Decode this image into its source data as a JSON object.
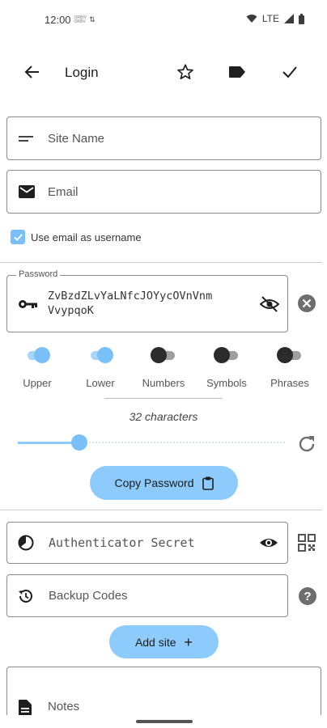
{
  "status_bar": {
    "time": "12:00",
    "tiny1": "ORBIV",
    "tiny2": "ORBV",
    "network": "LTE"
  },
  "app_bar": {
    "title": "Login"
  },
  "fields": {
    "site_name": "Site Name",
    "email": "Email",
    "use_email_label": "Use email as username",
    "password_label": "Password",
    "password_value_line1": "ZvBzdZLvYaLNfcJOYycOVnVnm",
    "password_value_line2": "VvypqoK",
    "authenticator_placeholder": "Authenticator Secret",
    "backup_codes": "Backup Codes",
    "notes": "Notes"
  },
  "options": [
    {
      "label": "Upper",
      "on": true
    },
    {
      "label": "Lower",
      "on": true
    },
    {
      "label": "Numbers",
      "on": false
    },
    {
      "label": "Symbols",
      "on": false
    },
    {
      "label": "Phrases",
      "on": false
    }
  ],
  "length": {
    "label": "32 characters",
    "value": 32,
    "fill_fraction": 0.23
  },
  "buttons": {
    "copy_password": "Copy Password",
    "add_site": "Add site"
  },
  "colors": {
    "accent": "#8ccbfb",
    "checkbox": "#7ac0f8",
    "icon": "#1f1f1f"
  }
}
